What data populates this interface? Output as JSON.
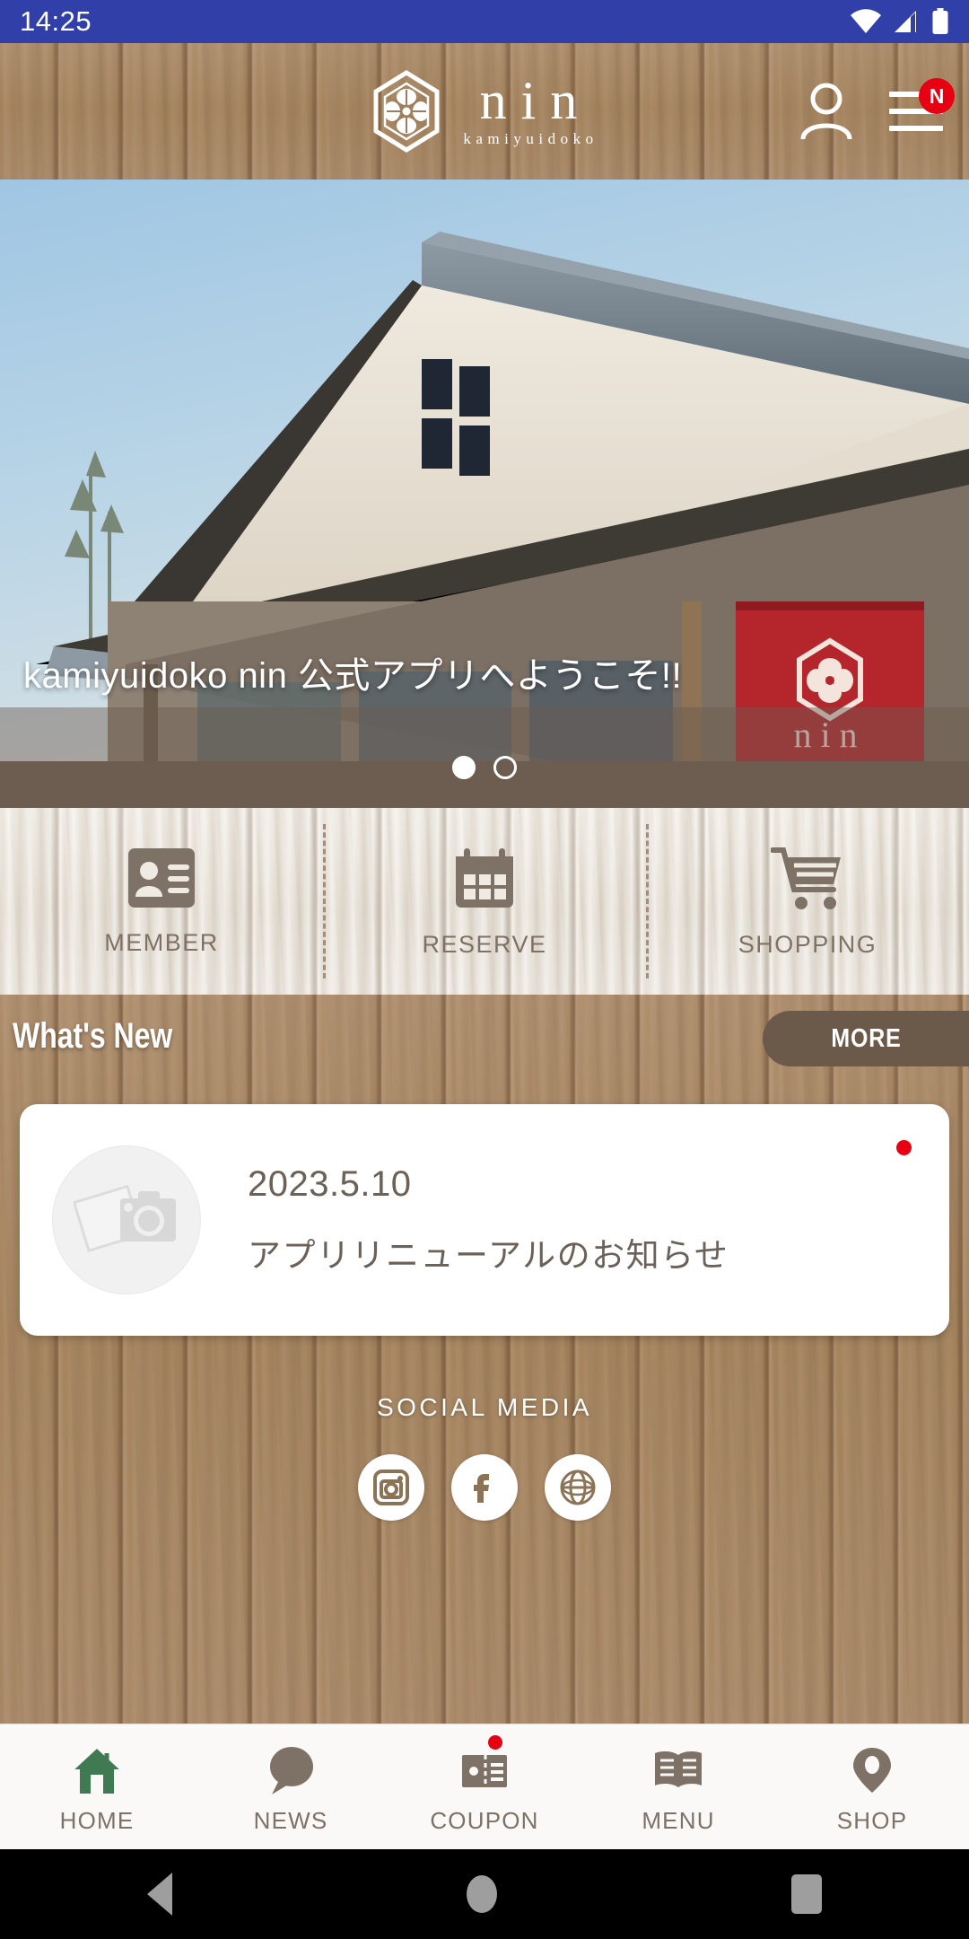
{
  "status_bar": {
    "clock": "14:25",
    "icons": [
      "wifi-icon",
      "cellular-signal-icon",
      "battery-icon"
    ],
    "background": "#3040a8"
  },
  "app_bar": {
    "logo_mark": "hexagon-floral-crest-icon",
    "brand": "nin",
    "brand_sub": "kamiyuidoko",
    "account_icon": "person-icon",
    "menu_icon": "hamburger-menu-icon",
    "menu_badge": "N",
    "menu_badge_color": "#e60012"
  },
  "hero": {
    "caption": "kamiyuidoko nin 公式アプリへようこそ!!",
    "slide_count": 2,
    "active_slide": 1,
    "image_description": "traditional Japanese tiled-roof salon building with red banner"
  },
  "quick_actions": [
    {
      "label": "MEMBER",
      "icon": "id-card-icon"
    },
    {
      "label": "RESERVE",
      "icon": "calendar-icon"
    },
    {
      "label": "SHOPPING",
      "icon": "shopping-cart-icon"
    }
  ],
  "whats_new": {
    "title": "What's New",
    "more_label": "MORE",
    "more_color": "#6b5949",
    "items": [
      {
        "date": "2023.5.10",
        "title": "アプリリニューアルのお知らせ",
        "thumb_icon": "photo-placeholder-icon",
        "unread": true,
        "unread_color": "#e60012"
      }
    ]
  },
  "social": {
    "title": "SOCIAL MEDIA",
    "links": [
      {
        "name": "instagram",
        "icon": "instagram-icon"
      },
      {
        "name": "facebook",
        "icon": "facebook-icon"
      },
      {
        "name": "website",
        "icon": "globe-icon"
      }
    ]
  },
  "bottom_nav": {
    "active": "HOME",
    "active_color": "#3f7a52",
    "inactive_color": "#7e7165",
    "items": [
      {
        "label": "HOME",
        "icon": "home-icon",
        "badge": false
      },
      {
        "label": "NEWS",
        "icon": "speech-bubble-icon",
        "badge": false
      },
      {
        "label": "COUPON",
        "icon": "coupon-ticket-icon",
        "badge": true
      },
      {
        "label": "MENU",
        "icon": "open-book-icon",
        "badge": false
      },
      {
        "label": "SHOP",
        "icon": "map-pin-icon",
        "badge": false
      }
    ]
  },
  "system_nav": {
    "back": "back-triangle-icon",
    "home": "home-circle-icon",
    "recents": "recents-square-icon"
  }
}
